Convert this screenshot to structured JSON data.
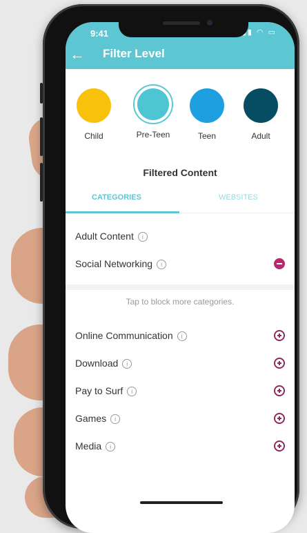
{
  "status": {
    "time": "9:41",
    "icons": "▮▮▮ ◠ ▭"
  },
  "header": {
    "title": "Filter Level",
    "back_icon": "←"
  },
  "levels": [
    {
      "label": "Child",
      "color": "#f8c20c",
      "selected": false
    },
    {
      "label": "Pre-Teen",
      "color": "#4ec5d2",
      "selected": true
    },
    {
      "label": "Teen",
      "color": "#1d9fe0",
      "selected": false
    },
    {
      "label": "Adult",
      "color": "#064c62",
      "selected": false
    }
  ],
  "filtered_content": {
    "title": "Filtered Content"
  },
  "tabs": [
    {
      "label": "CATEGORIES",
      "active": true
    },
    {
      "label": "WEBSITES",
      "active": false
    }
  ],
  "blocked": [
    {
      "label": "Adult Content",
      "action": null
    },
    {
      "label": "Social Networking",
      "action": "remove"
    }
  ],
  "hint": "Tap to block more categories.",
  "available": [
    {
      "label": "Online Communication",
      "action": "add"
    },
    {
      "label": "Download",
      "action": "add"
    },
    {
      "label": "Pay to Surf",
      "action": "add"
    },
    {
      "label": "Games",
      "action": "add"
    },
    {
      "label": "Media",
      "action": "add"
    }
  ],
  "info_icon": "i"
}
